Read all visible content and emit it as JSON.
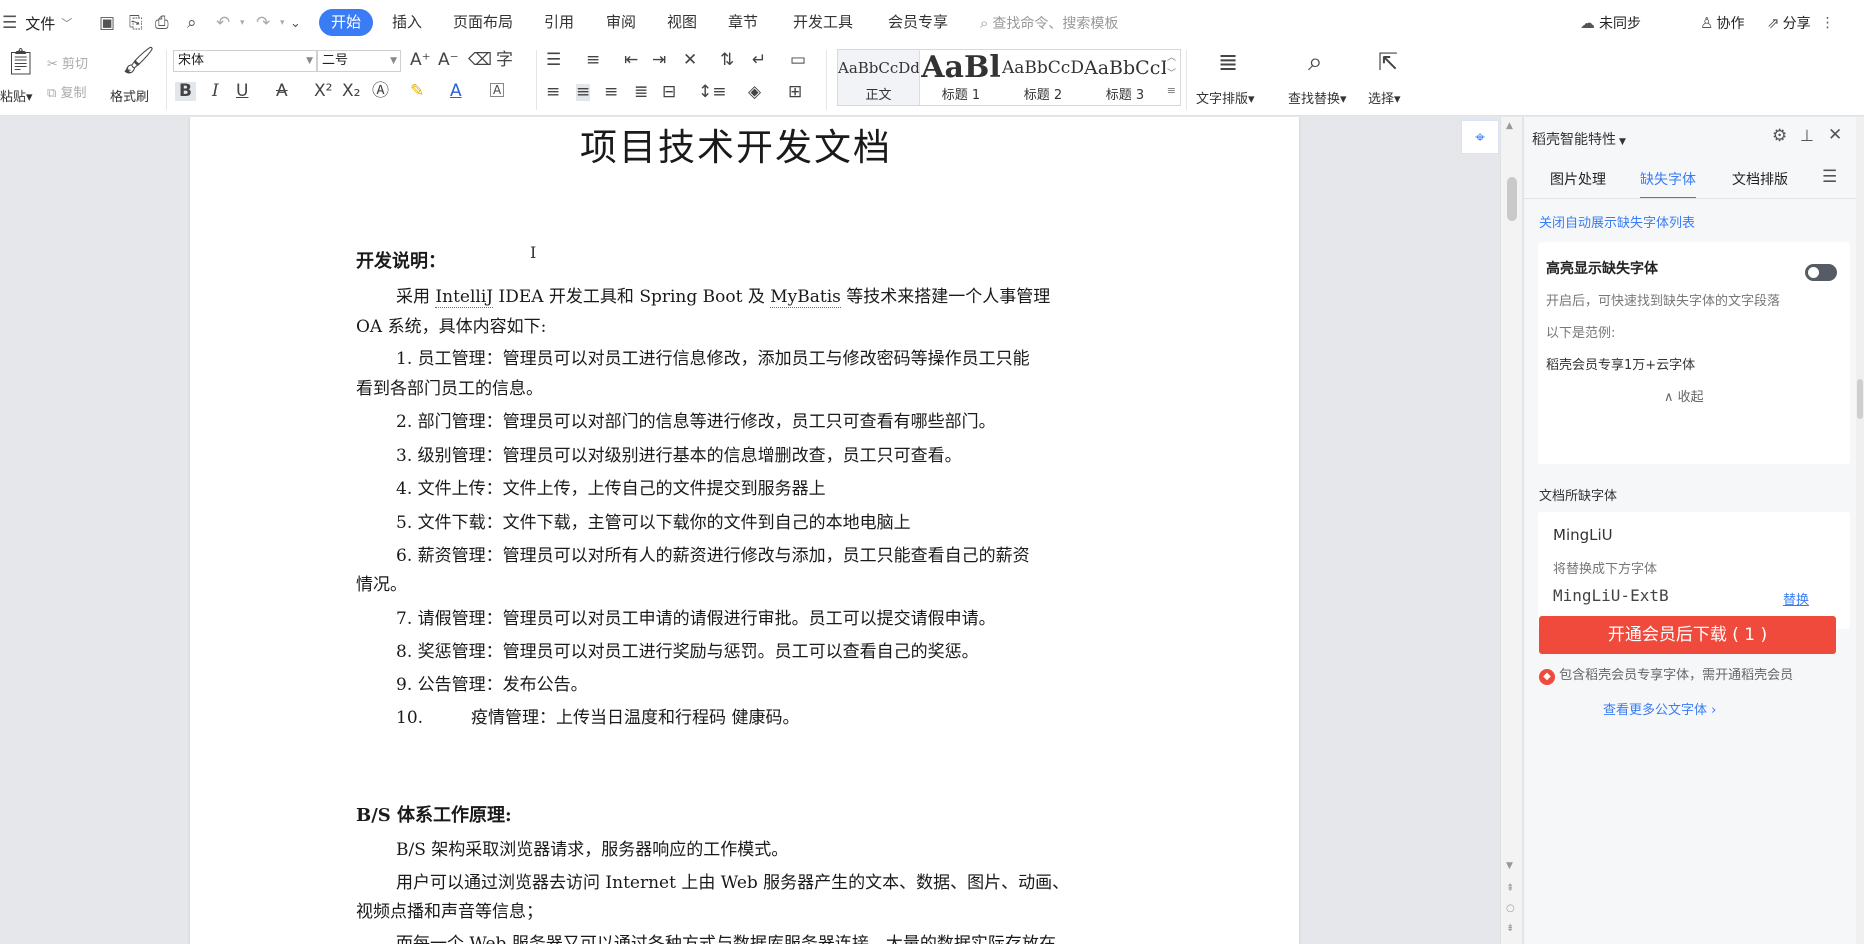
{
  "menu": {
    "file": "文件",
    "tabs": [
      "开始",
      "插入",
      "页面布局",
      "引用",
      "审阅",
      "视图",
      "章节",
      "开发工具",
      "会员专享"
    ],
    "search_placeholder": "查找命令、搜索模板",
    "sync": "未同步",
    "collab": "协作",
    "share": "分享"
  },
  "ribbon": {
    "paste": "粘贴▾",
    "cut": "剪切",
    "copy": "复制",
    "format_painter": "格式刷",
    "font_name": "宋体",
    "font_size": "二号",
    "styles": [
      {
        "preview": "AaBbCcDd",
        "label": "正文"
      },
      {
        "preview": "AaBl",
        "label": "标题 1"
      },
      {
        "preview": "AaBbCcDd",
        "label": "标题 2"
      },
      {
        "preview": "AaBbCcI",
        "label": "标题 3"
      }
    ],
    "text_layout": "文字排版▾",
    "find_replace": "查找替换▾",
    "select": "选择▾"
  },
  "doc": {
    "title": "项目技术开发文档",
    "h1": "开发说明：",
    "p1a": "采用 ",
    "p1b": "IntelliJ",
    "p1c": " IDEA 开发工具和 Spring Boot 及 ",
    "p1d": "MyBatis",
    "p1e": " 等技术来搭建一个人事管理",
    "p1f": "OA 系统，具体内容如下:",
    "items": [
      "1.  员工管理：管理员可以对员工进行信息修改，添加员工与修改密码等操作员工只能",
      "看到各部门员工的信息。",
      "2.  部门管理：管理员可以对部门的信息等进行修改，员工只可查看有哪些部门。",
      "3.  级别管理：管理员可以对级别进行基本的信息增删改查，员工只可查看。",
      "4.  文件上传：文件上传，上传自己的文件提交到服务器上",
      "5.  文件下载：文件下载，主管可以下载你的文件到自己的本地电脑上",
      "6.  薪资管理：管理员可以对所有人的薪资进行修改与添加，员工只能查看自己的薪资",
      "情况。",
      "7.  请假管理：管理员可以对员工申请的请假进行审批。员工可以提交请假申请。",
      "8.  奖惩管理：管理员可以对员工进行奖励与惩罚。员工可以查看自己的奖惩。",
      "9.  公告管理：发布公告。"
    ],
    "item10_num": "10.",
    "item10_text": "疫情管理：上传当日温度和行程码 健康码。",
    "h2": "B/S 体系工作原理:",
    "p2": "B/S 架构采取浏览器请求，服务器响应的工作模式。",
    "p3a": "用户可以通过浏览器去访问 Internet 上由 Web 服务器产生的文本、数据、图片、动画、",
    "p3b": "视频点播和声音等信息；",
    "p4": "而每一个 Web 服务器又可以通过各种方式与数据库服务器连接，大量的数据实际存放在"
  },
  "panel": {
    "title": "稻壳智能特性",
    "tabs": [
      "图片处理",
      "缺失字体",
      "文档排版"
    ],
    "close_auto_link": "关闭自动展示缺失字体列表",
    "highlight": {
      "title": "高亮显示缺失字体",
      "desc": "开启后，可快速找到缺失字体的文字段落",
      "example_label": "以下是范例:",
      "example_text": "稻壳会员专享1万+云字体",
      "collapse": "收起"
    },
    "missing_heading": "文档所缺字体",
    "missing_font": "MingLiU",
    "replace_hint": "将替换成下方字体",
    "replacement_font": "MingLiU-ExtB",
    "replace_action": "替换",
    "download_btn": "开通会员后下载 ( 1 )",
    "member_note": "包含稻壳会员专享字体，需开通稻壳会员",
    "more_fonts": "查看更多公文字体"
  }
}
